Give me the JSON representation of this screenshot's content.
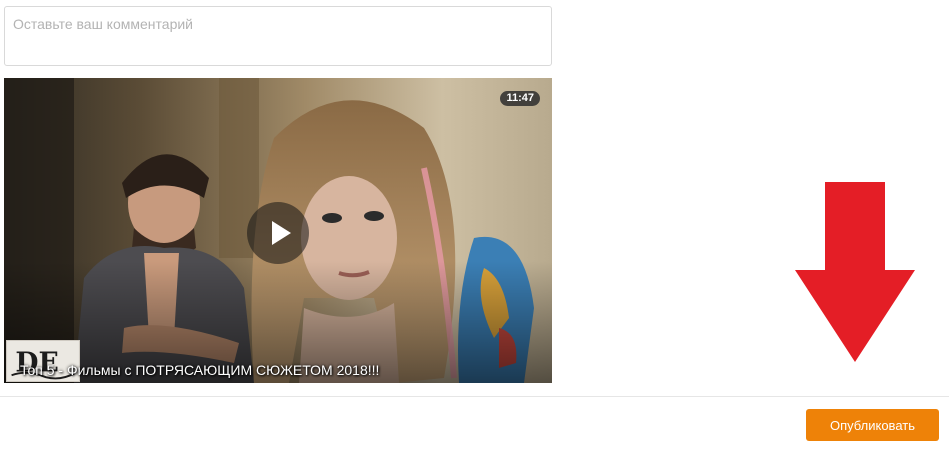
{
  "comment": {
    "placeholder": "Оставьте ваш комментарий"
  },
  "video": {
    "duration": "11:47",
    "title": "Топ 5 - Фильмы с ПОТРЯСАЮЩИМ СЮЖЕТОМ 2018!!!",
    "channel_logo_text": "DE"
  },
  "actions": {
    "publish_label": "Опубликовать"
  },
  "colors": {
    "publish_button": "#ee8208",
    "annotation_arrow": "#e41e26"
  },
  "icons": {
    "play": "play-icon",
    "arrow": "arrow-down-icon"
  }
}
